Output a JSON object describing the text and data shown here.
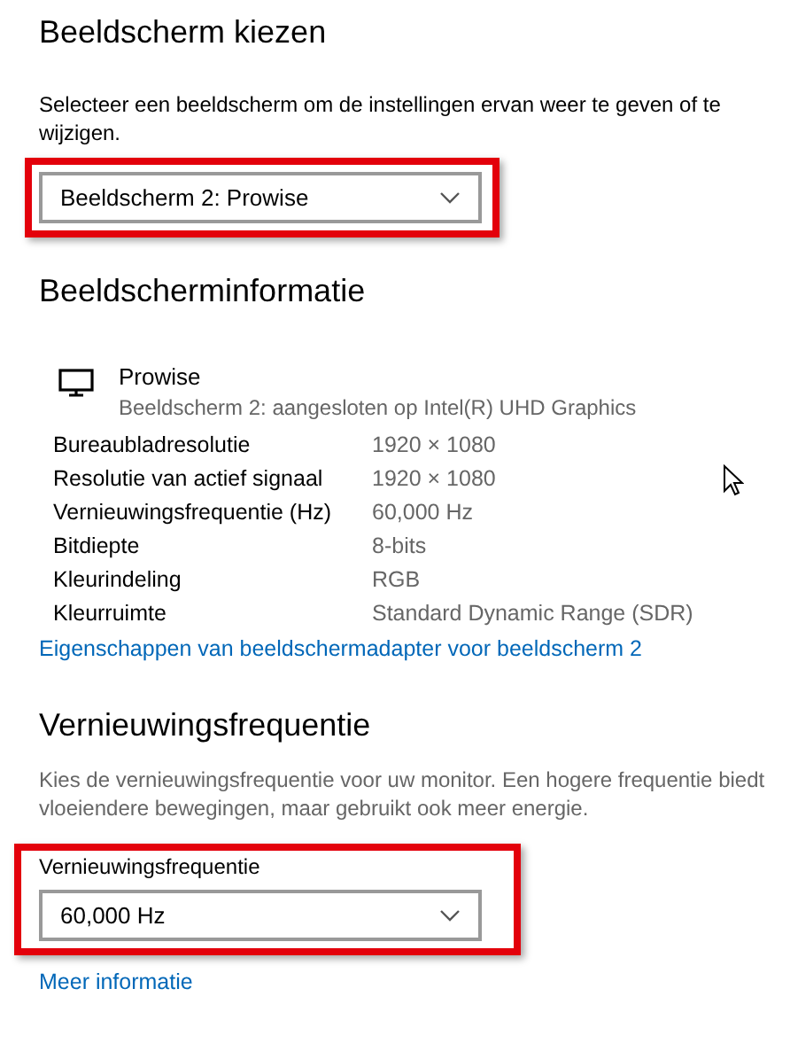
{
  "choose_display": {
    "title": "Beeldscherm kiezen",
    "description": "Selecteer een beeldscherm om de instellingen ervan weer te geven of te wijzigen.",
    "dropdown": {
      "value": "Beeldscherm 2: Prowise",
      "highlighted": true
    }
  },
  "display_info": {
    "title": "Beeldscherminformatie",
    "monitor": {
      "name": "Prowise",
      "detail": "Beeldscherm 2: aangesloten op Intel(R) UHD Graphics"
    },
    "rows": [
      {
        "label": "Bureaubladresolutie",
        "value": "1920 × 1080"
      },
      {
        "label": "Resolutie van actief signaal",
        "value": "1920 × 1080"
      },
      {
        "label": "Vernieuwingsfrequentie (Hz)",
        "value": "60,000 Hz"
      },
      {
        "label": "Bitdiepte",
        "value": "8-bits"
      },
      {
        "label": "Kleurindeling",
        "value": "RGB"
      },
      {
        "label": "Kleurruimte",
        "value": "Standard Dynamic Range (SDR)"
      }
    ],
    "link": "Eigenschappen van beeldschermadapter voor beeldscherm 2"
  },
  "refresh_rate": {
    "title": "Vernieuwingsfrequentie",
    "description": "Kies de vernieuwingsfrequentie voor uw monitor. Een hogere frequentie biedt vloeiendere bewegingen, maar gebruikt ook meer energie.",
    "field_label": "Vernieuwingsfrequentie",
    "dropdown": {
      "value": "60,000 Hz",
      "highlighted": true
    },
    "link": "Meer informatie"
  }
}
